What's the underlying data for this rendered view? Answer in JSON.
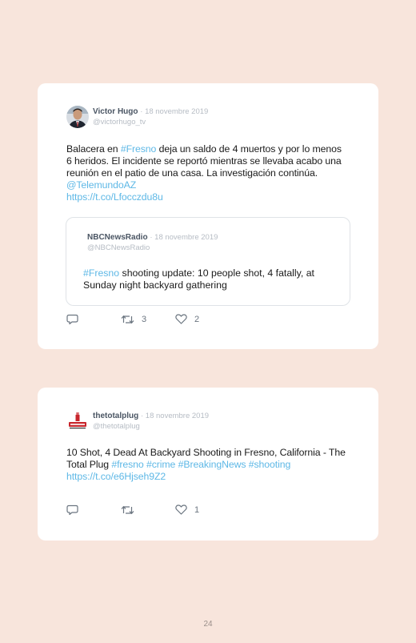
{
  "tweets": [
    {
      "author": "Victor Hugo",
      "date": "· 18 novembre 2019",
      "handle": "@victorhugo_tv",
      "text_parts": [
        {
          "t": "Balacera en ",
          "link": false
        },
        {
          "t": "#Fresno",
          "link": true
        },
        {
          "t": " deja un saldo de 4 muertos y por lo menos 6 heridos. El incidente se reportó mientras se llevaba acabo una reunión en el patio de una casa. La investigación continúa. ",
          "link": false
        },
        {
          "t": "@TelemundoAZ",
          "link": true
        },
        {
          "t": " ",
          "link": false
        },
        {
          "t": "https://t.co/Lfocczdu8u",
          "link": true
        }
      ],
      "quote": {
        "author": "NBCNewsRadio",
        "date": "· 18 novembre 2019",
        "handle": "@NBCNewsRadio",
        "text_parts": [
          {
            "t": "#Fresno",
            "link": true
          },
          {
            "t": " shooting update: 10 people shot, 4 fatally, at Sunday night backyard gathering",
            "link": false
          }
        ]
      },
      "actions": {
        "reply_icon": "reply-icon",
        "retweet_icon": "retweet-icon",
        "retweets": "3",
        "like_icon": "heart-icon",
        "likes": "2"
      }
    },
    {
      "author": "thetotalplug",
      "date": "· 18 novembre 2019",
      "handle": "@thetotalplug",
      "text_parts": [
        {
          "t": "10 Shot, 4 Dead At Backyard Shooting in Fresno, California - The Total Plug ",
          "link": false
        },
        {
          "t": "#fresno",
          "link": true
        },
        {
          "t": " ",
          "link": false
        },
        {
          "t": "#crime",
          "link": true
        },
        {
          "t": " ",
          "link": false
        },
        {
          "t": "#BreakingNews",
          "link": true
        },
        {
          "t": " ",
          "link": false
        },
        {
          "t": "#shooting",
          "link": true
        },
        {
          "t": " ",
          "link": false
        },
        {
          "t": "https://t.co/e6Hjseh9Z2",
          "link": true
        }
      ],
      "actions": {
        "reply_icon": "reply-icon",
        "retweet_icon": "retweet-icon",
        "retweets": "",
        "like_icon": "heart-icon",
        "likes": "1"
      }
    }
  ],
  "page_number": "24",
  "colors": {
    "background": "#f8e5dc",
    "link": "#5eb8e6",
    "muted": "#b6bcc4",
    "name": "#4a5563"
  }
}
